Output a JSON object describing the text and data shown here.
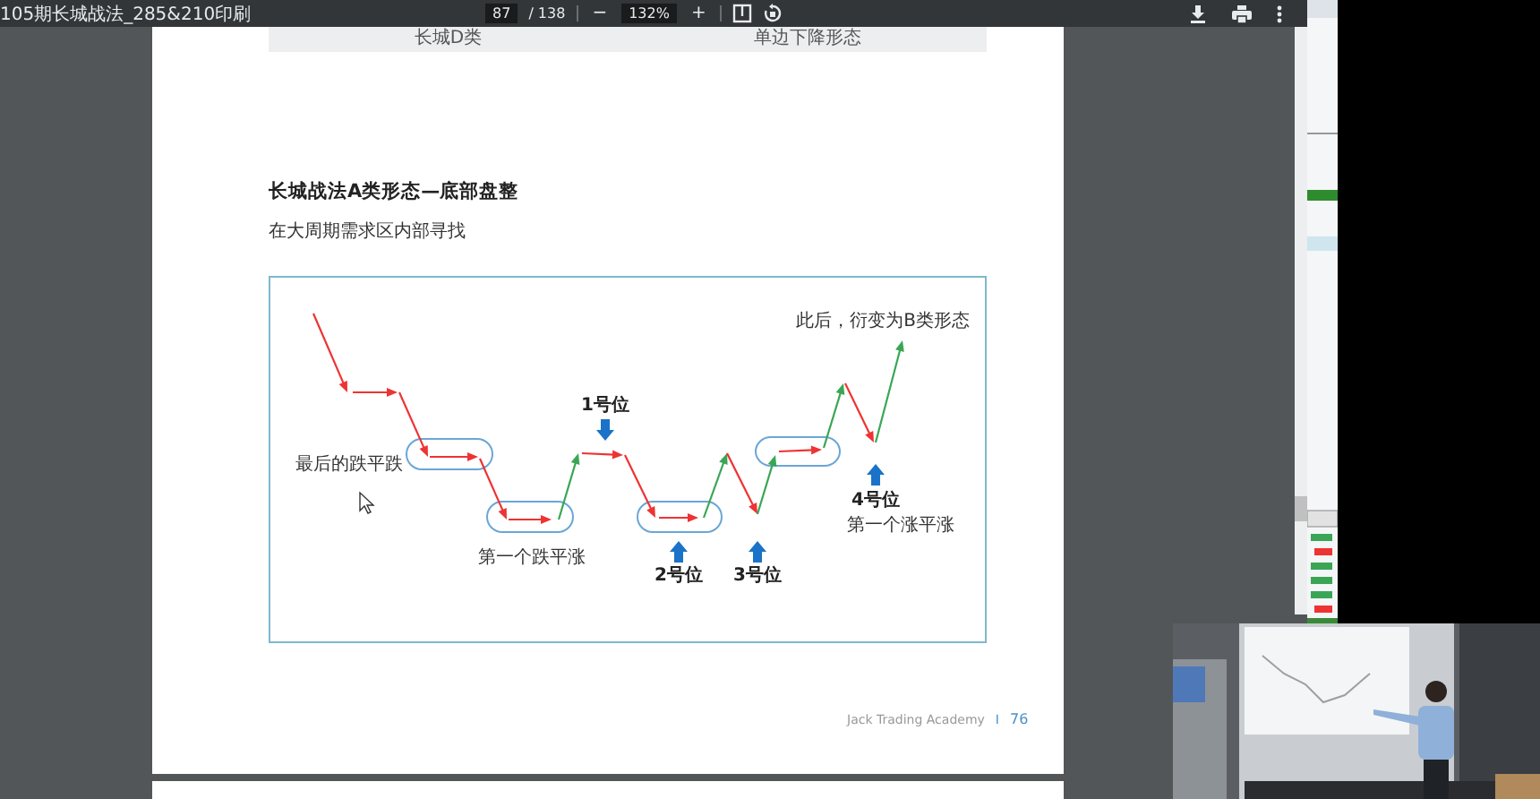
{
  "viewer": {
    "title": "105期长城战法_285&210印刷",
    "page_input": "87",
    "page_total": "/ 138",
    "zoom_out": "−",
    "zoom": "132%",
    "zoom_in": "+"
  },
  "page": {
    "table_row": [
      "长城D类",
      "单边下降形态"
    ],
    "heading": "长城战法A类形态—底部盘整",
    "subtitle": "在大周期需求区内部寻找",
    "diagram": {
      "notes": [
        "最后的跌平跌",
        "第一个跌平涨",
        "此后，衍变为B类形态",
        "第一个涨平涨"
      ],
      "positions": [
        "1号位",
        "2号位",
        "3号位",
        "4号位"
      ]
    },
    "footer": {
      "brand": "Jack Trading Academy",
      "separator": "I",
      "page_number": "76"
    }
  }
}
